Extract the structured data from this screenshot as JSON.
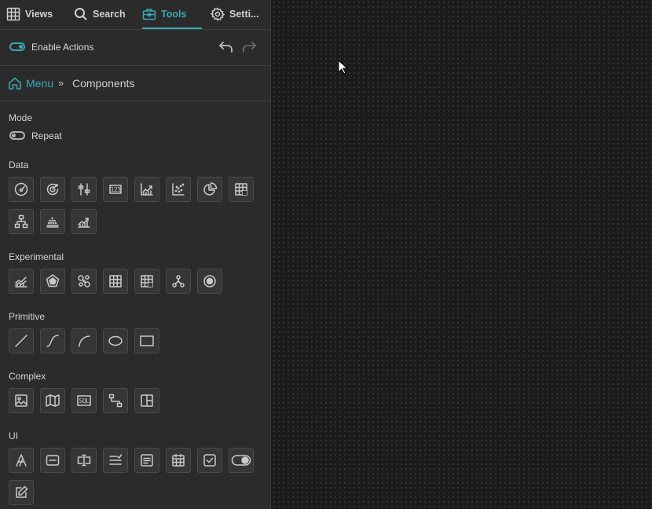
{
  "tabs": [
    {
      "label": "Views",
      "icon": "grid-icon"
    },
    {
      "label": "Search",
      "icon": "search-icon"
    },
    {
      "label": "Tools",
      "icon": "toolbox-icon",
      "active": true
    },
    {
      "label": "Setti...",
      "icon": "gear-icon"
    }
  ],
  "actions": {
    "toggle_label": "Enable Actions",
    "enabled": true
  },
  "breadcrumb": {
    "root": "Menu",
    "current": "Components"
  },
  "mode": {
    "title": "Mode",
    "toggle_label": "Repeat",
    "enabled": false
  },
  "sections": {
    "data": "Data",
    "experimental": "Experimental",
    "primitive": "Primitive",
    "complex": "Complex",
    "ui": "UI"
  },
  "icon_text": {
    "number": "123",
    "sql": "SQL"
  },
  "colors": {
    "accent": "#3aa7b5",
    "panel": "#2b2b2b",
    "canvas": "#1b1b1b"
  }
}
